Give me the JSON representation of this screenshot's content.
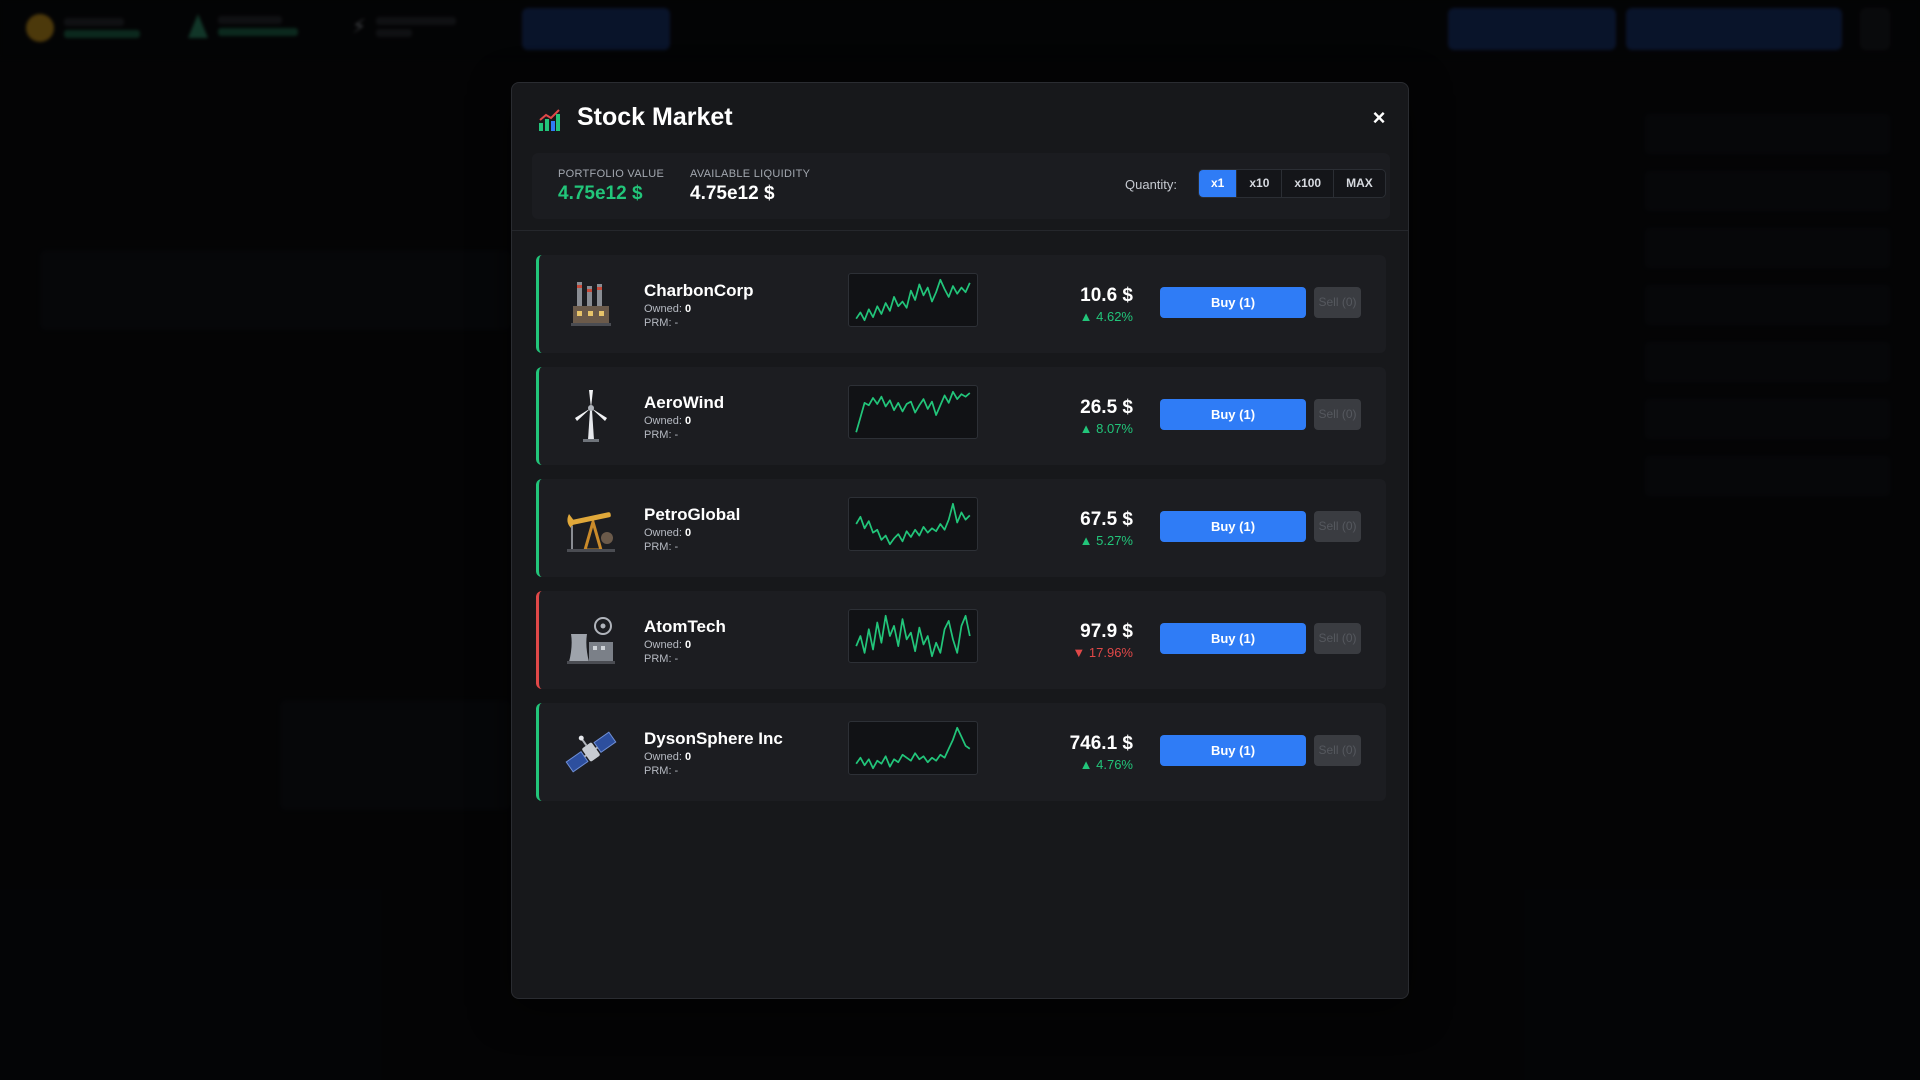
{
  "modal": {
    "title": "Stock Market",
    "title_icon": "chart-icon",
    "close_label": "×"
  },
  "summary": {
    "portfolio_label": "PORTFOLIO VALUE",
    "portfolio_value": "4.75e12 $",
    "liquidity_label": "AVAILABLE LIQUIDITY",
    "liquidity_value": "4.75e12 $",
    "quantity_label": "Quantity:",
    "quantity_options": [
      "x1",
      "x10",
      "x100",
      "MAX"
    ],
    "quantity_selected": "x1"
  },
  "stocks": [
    {
      "name": "CharbonCorp",
      "icon": "factory-icon",
      "owned_label": "Owned:",
      "owned": "0",
      "prm": "PRM: -",
      "price": "10.6 $",
      "change": "▲ 4.62%",
      "trend": "up",
      "buy_label": "Buy (1)",
      "sell_label": "Sell (0)",
      "spark": [
        30,
        34,
        29,
        36,
        31,
        38,
        33,
        40,
        35,
        44,
        38,
        41,
        37,
        48,
        42,
        52,
        45,
        50,
        41,
        47,
        55,
        49,
        44,
        51,
        46,
        50,
        47,
        53
      ]
    },
    {
      "name": "AeroWind",
      "icon": "wind-turbine-icon",
      "owned_label": "Owned:",
      "owned": "0",
      "prm": "PRM: -",
      "price": "26.5 $",
      "change": "▲ 8.07%",
      "trend": "up",
      "buy_label": "Buy (1)",
      "sell_label": "Sell (0)",
      "spark": [
        22,
        34,
        46,
        44,
        50,
        45,
        51,
        43,
        48,
        40,
        46,
        39,
        45,
        47,
        38,
        44,
        49,
        41,
        47,
        36,
        44,
        52,
        46,
        55,
        49,
        53,
        51,
        54
      ]
    },
    {
      "name": "PetroGlobal",
      "icon": "oil-pump-icon",
      "owned_label": "Owned:",
      "owned": "0",
      "prm": "PRM: -",
      "price": "67.5 $",
      "change": "▲ 5.27%",
      "trend": "up",
      "buy_label": "Buy (1)",
      "sell_label": "Sell (0)",
      "spark": [
        44,
        49,
        41,
        46,
        38,
        40,
        33,
        36,
        30,
        34,
        37,
        32,
        39,
        35,
        40,
        36,
        42,
        38,
        41,
        39,
        44,
        40,
        47,
        58,
        45,
        52,
        47,
        50
      ]
    },
    {
      "name": "AtomTech",
      "icon": "nuclear-plant-icon",
      "owned_label": "Owned:",
      "owned": "0",
      "prm": "PRM: -",
      "price": "97.9 $",
      "change": "▼ 17.96%",
      "trend": "down",
      "buy_label": "Buy (1)",
      "sell_label": "Sell (0)",
      "spark": [
        34,
        40,
        30,
        44,
        32,
        48,
        36,
        52,
        40,
        46,
        34,
        50,
        38,
        42,
        31,
        45,
        35,
        40,
        28,
        36,
        30,
        44,
        49,
        38,
        30,
        46,
        52,
        40
      ]
    },
    {
      "name": "DysonSphere Inc",
      "icon": "satellite-icon",
      "owned_label": "Owned:",
      "owned": "0",
      "prm": "PRM: -",
      "price": "746.1 $",
      "change": "▲ 4.76%",
      "trend": "up",
      "buy_label": "Buy (1)",
      "sell_label": "Sell (0)",
      "spark": [
        34,
        38,
        33,
        37,
        31,
        36,
        34,
        39,
        32,
        37,
        35,
        40,
        38,
        36,
        41,
        37,
        39,
        35,
        38,
        36,
        40,
        38,
        44,
        50,
        58,
        52,
        46,
        44
      ]
    }
  ],
  "colors": {
    "up": "#22c57a",
    "down": "#e04848",
    "accent": "#2f7cf6"
  }
}
